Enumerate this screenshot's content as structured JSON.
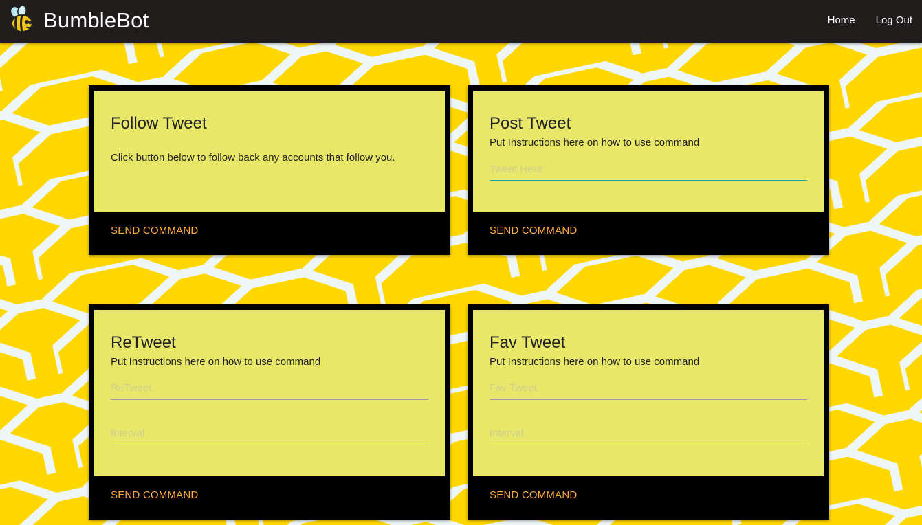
{
  "navbar": {
    "brand": "BumbleBot",
    "links": [
      "Home",
      "Log Out"
    ]
  },
  "cards": [
    {
      "title": "Follow Tweet",
      "description": "Click button below to follow back any accounts that follow you.",
      "button": "SEND COMMAND"
    },
    {
      "title": "Post Tweet",
      "description": "Put Instructions here on how to use command",
      "fields": [
        {
          "placeholder": "Tweet Here"
        }
      ],
      "button": "SEND COMMAND"
    },
    {
      "title": "ReTweet",
      "description": "Put Instructions here on how to use command",
      "fields": [
        {
          "placeholder": "ReTweet"
        },
        {
          "placeholder": "Interval"
        }
      ],
      "button": "SEND COMMAND"
    },
    {
      "title": "Fav Tweet",
      "description": "Put Instructions here on how to use command",
      "fields": [
        {
          "placeholder": "Fav Tweet"
        },
        {
          "placeholder": "Interval"
        }
      ],
      "button": "SEND COMMAND"
    }
  ],
  "icons": {
    "logo": "bee-icon"
  },
  "colors": {
    "background": "#ffd700",
    "honeycomb_lines": "#eef6f7",
    "navbar": "#211d1d",
    "card_frame": "#000000",
    "card_body": "#e8e769",
    "button_text": "#ffab40",
    "active_field_underline": "#26a69a"
  }
}
